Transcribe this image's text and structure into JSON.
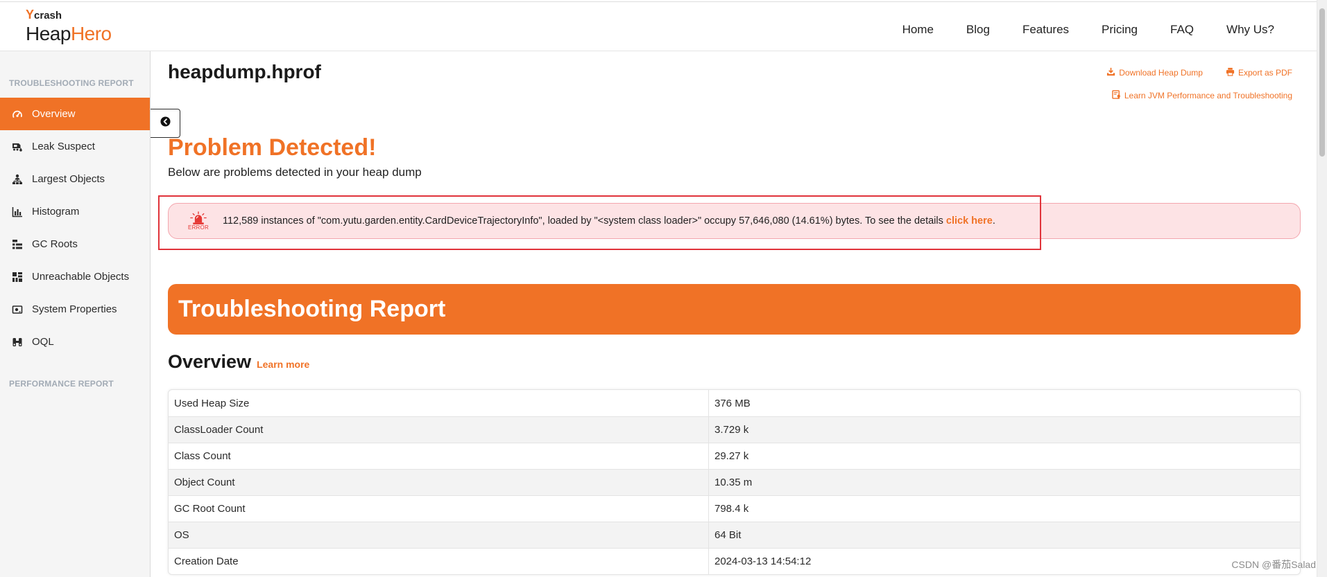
{
  "brand": {
    "top_prefix": "Y",
    "top_suffix": "crash",
    "name_a": "Heap",
    "name_b": "Hero"
  },
  "nav": {
    "items": [
      "Home",
      "Blog",
      "Features",
      "Pricing",
      "FAQ",
      "Why Us?"
    ]
  },
  "sidebar": {
    "section1": "TROUBLESHOOTING REPORT",
    "items": [
      {
        "label": "Overview",
        "icon": "dashboard-icon",
        "active": true
      },
      {
        "label": "Leak Suspect",
        "icon": "leak-icon"
      },
      {
        "label": "Largest Objects",
        "icon": "hierarchy-icon"
      },
      {
        "label": "Histogram",
        "icon": "bar-chart-icon"
      },
      {
        "label": "GC Roots",
        "icon": "list-tree-icon"
      },
      {
        "label": "Unreachable Objects",
        "icon": "grid-icon"
      },
      {
        "label": "System Properties",
        "icon": "id-card-icon"
      },
      {
        "label": "OQL",
        "icon": "binoculars-icon"
      }
    ],
    "section2": "PERFORMANCE REPORT",
    "collapse_icon": "chevron-left-circle-icon"
  },
  "main": {
    "file_title": "heapdump.hprof",
    "actions": {
      "download": "Download Heap Dump",
      "export": "Export as PDF",
      "learn": "Learn JVM Performance and Troubleshooting"
    },
    "problem": {
      "heading": "Problem Detected!",
      "subheading": "Below are problems detected in your heap dump",
      "badge": "ERROR",
      "message": "112,589 instances of \"com.yutu.garden.entity.CardDeviceTrajectoryInfo\", loaded by \"<system class loader>\" occupy 57,646,080 (14.61%) bytes. To see the details ",
      "link": "click here",
      "message_end": "."
    },
    "report_banner": "Troubleshooting Report",
    "overview": {
      "heading": "Overview",
      "learn_more": "Learn more",
      "rows": [
        {
          "label": "Used Heap Size",
          "value": "376 MB"
        },
        {
          "label": "ClassLoader Count",
          "value": "3.729 k"
        },
        {
          "label": "Class Count",
          "value": "29.27 k"
        },
        {
          "label": "Object Count",
          "value": "10.35 m"
        },
        {
          "label": "GC Root Count",
          "value": "798.4 k"
        },
        {
          "label": "OS",
          "value": "64 Bit"
        },
        {
          "label": "Creation Date",
          "value": "2024-03-13 14:54:12"
        }
      ]
    }
  },
  "colors": {
    "accent": "#f07226",
    "error_bg": "#fde3e5",
    "error_border": "#f3a6ae",
    "annotation": "#e0333a",
    "sidebar_bg": "#f5f5f5"
  },
  "watermark": "CSDN @番茄Salad"
}
